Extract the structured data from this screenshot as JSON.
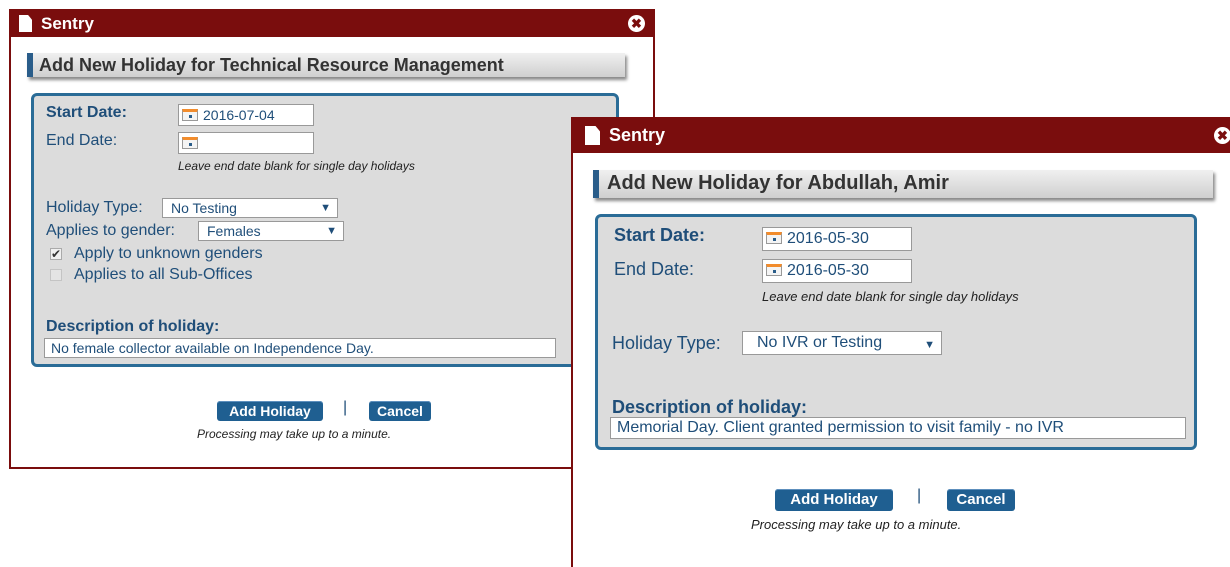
{
  "colors": {
    "titlebar": "#7a0d0d",
    "accent": "#1f5f91",
    "label": "#1f4e79",
    "panel_bg": "#dcdcdc"
  },
  "icons": {
    "title": "document-icon",
    "close": "close-circle-icon",
    "calendar": "calendar-icon",
    "dropdown": "chevron-down-icon"
  },
  "dialog1": {
    "window_title": "Sentry",
    "close_symbol": "✖",
    "heading": "Add New Holiday for Technical Resource Management",
    "start_date_label": "Start Date:",
    "start_date_value": "2016-07-04",
    "end_date_label": "End Date:",
    "end_date_value": "",
    "end_date_hint": "Leave end date blank for single day holidays",
    "holiday_type_label": "Holiday Type:",
    "holiday_type_value": "No Testing",
    "gender_label": "Applies to gender:",
    "gender_value": "Females",
    "checkbox_unknown_label": "Apply to unknown genders",
    "checkbox_unknown_checked": true,
    "checkbox_suboffices_label": "Applies to all Sub-Offices",
    "checkbox_suboffices_checked": false,
    "description_label": "Description of holiday:",
    "description_value": "No female collector available on Independence Day.",
    "add_button": "Add Holiday",
    "separator": "|",
    "cancel_button": "Cancel",
    "processing_note": "Processing may take up to a minute."
  },
  "dialog2": {
    "window_title": "Sentry",
    "close_symbol": "✖",
    "heading": "Add New Holiday for Abdullah, Amir",
    "start_date_label": "Start Date:",
    "start_date_value": "2016-05-30",
    "end_date_label": "End Date:",
    "end_date_value": "2016-05-30",
    "end_date_hint": "Leave end date blank for single day holidays",
    "holiday_type_label": "Holiday Type:",
    "holiday_type_value": "No IVR or Testing",
    "description_label": "Description of holiday:",
    "description_value": "Memorial Day. Client granted permission to visit family - no IVR",
    "add_button": "Add Holiday",
    "separator": "|",
    "cancel_button": "Cancel",
    "processing_note": "Processing may take up to a minute."
  }
}
